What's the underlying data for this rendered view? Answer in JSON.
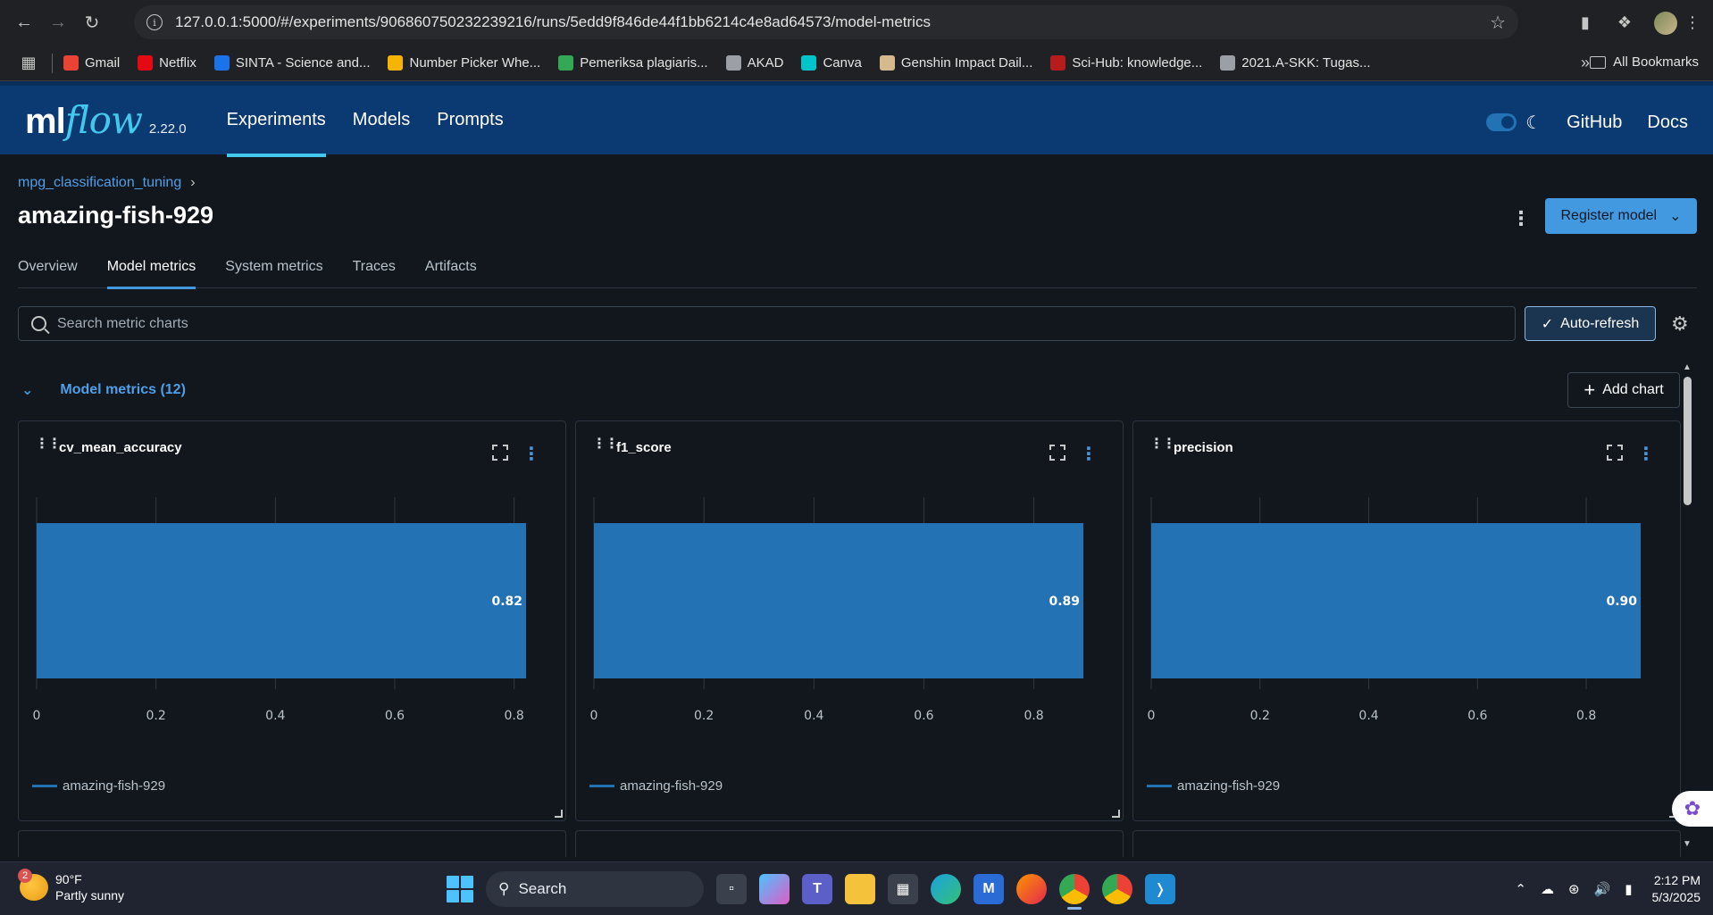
{
  "browser": {
    "url": "127.0.0.1:5000/#/experiments/906860750232239216/runs/5edd9f846de44f1bb6214c4e8ad64573/model-metrics",
    "bookmarks": [
      {
        "label": "Gmail",
        "color": "#ea4335"
      },
      {
        "label": "Netflix",
        "color": "#e50914"
      },
      {
        "label": "SINTA - Science and...",
        "color": "#1a73e8"
      },
      {
        "label": "Number Picker Whe...",
        "color": "#f4b400"
      },
      {
        "label": "Pemeriksa plagiaris...",
        "color": "#34a853"
      },
      {
        "label": "AKAD",
        "color": "#9aa0a6"
      },
      {
        "label": "Canva",
        "color": "#00c4cc"
      },
      {
        "label": "Genshin Impact Dail...",
        "color": "#d7b98e"
      },
      {
        "label": "Sci-Hub: knowledge...",
        "color": "#b71c1c"
      },
      {
        "label": "2021.A-SKK: Tugas...",
        "color": "#9aa0a6"
      }
    ],
    "all_bookmarks": "All Bookmarks"
  },
  "header": {
    "logo_ml": "ml",
    "logo_flow": "flow",
    "version": "2.22.0",
    "nav": [
      "Experiments",
      "Models",
      "Prompts"
    ],
    "github": "GitHub",
    "docs": "Docs"
  },
  "page": {
    "breadcrumb": "mpg_classification_tuning",
    "title": "amazing-fish-929",
    "register_button": "Register model",
    "tabs": [
      "Overview",
      "Model metrics",
      "System metrics",
      "Traces",
      "Artifacts"
    ],
    "search_placeholder": "Search metric charts",
    "auto_refresh": "Auto-refresh",
    "section_title": "Model metrics (12)",
    "add_chart": "Add chart"
  },
  "chart_data": [
    {
      "type": "bar",
      "title": "cv_mean_accuracy",
      "categories": [
        "amazing-fish-929"
      ],
      "values": [
        0.82
      ],
      "value_label": "0.82",
      "xlim": [
        0,
        0.82
      ],
      "xticks": [
        "0",
        "0.2",
        "0.4",
        "0.6",
        "0.8"
      ],
      "legend": [
        "amazing-fish-929"
      ],
      "color": "#2272b4"
    },
    {
      "type": "bar",
      "title": "f1_score",
      "categories": [
        "amazing-fish-929"
      ],
      "values": [
        0.89
      ],
      "value_label": "0.89",
      "xlim": [
        0,
        0.89
      ],
      "xticks": [
        "0",
        "0.2",
        "0.4",
        "0.6",
        "0.8"
      ],
      "legend": [
        "amazing-fish-929"
      ],
      "color": "#2272b4"
    },
    {
      "type": "bar",
      "title": "precision",
      "categories": [
        "amazing-fish-929"
      ],
      "values": [
        0.9
      ],
      "value_label": "0.90",
      "xlim": [
        0,
        0.9
      ],
      "xticks": [
        "0",
        "0.2",
        "0.4",
        "0.6",
        "0.8"
      ],
      "legend": [
        "amazing-fish-929"
      ],
      "color": "#2272b4"
    }
  ],
  "taskbar": {
    "temperature": "90°F",
    "condition": "Partly sunny",
    "weather_badge": "2",
    "search": "Search",
    "time": "2:12 PM",
    "date": "5/3/2025"
  }
}
